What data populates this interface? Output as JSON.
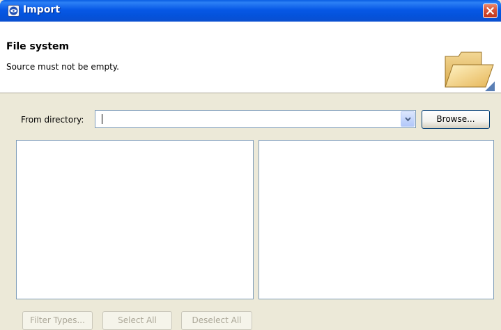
{
  "window": {
    "title": "Import",
    "icon": "gnu-app-icon",
    "close_icon": "close-icon"
  },
  "banner": {
    "title": "File system",
    "message": "Source must not be empty.",
    "graphic": "folder-icon"
  },
  "from_directory": {
    "label": "From directory:",
    "value": "",
    "browse_label": "Browse..."
  },
  "buttons": {
    "filter_types": "Filter Types...",
    "select_all": "Select All",
    "deselect_all": "Deselect All"
  },
  "colors": {
    "titlebar": "#0758e6",
    "dialog_bg": "#ece9d8",
    "panel_border": "#7f9db9",
    "disabled_text": "#aca899"
  }
}
